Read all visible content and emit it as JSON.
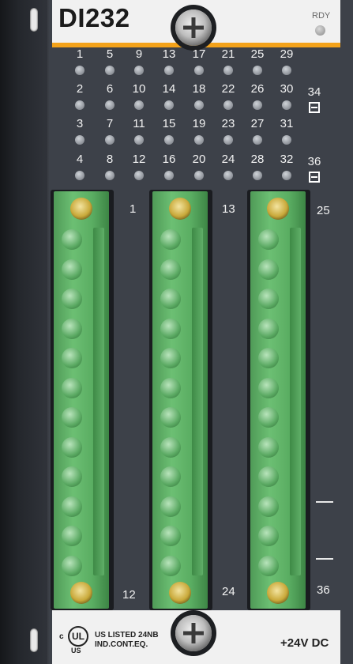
{
  "header": {
    "model": "DI232",
    "status_label": "RDY"
  },
  "leds": [
    {
      "label": "1"
    },
    {
      "label": "5"
    },
    {
      "label": "9"
    },
    {
      "label": "13"
    },
    {
      "label": "17"
    },
    {
      "label": "21"
    },
    {
      "label": "25"
    },
    {
      "label": "29"
    },
    {
      "label": "2"
    },
    {
      "label": "6"
    },
    {
      "label": "10"
    },
    {
      "label": "14"
    },
    {
      "label": "18"
    },
    {
      "label": "22"
    },
    {
      "label": "26"
    },
    {
      "label": "30"
    },
    {
      "label": "3"
    },
    {
      "label": "7"
    },
    {
      "label": "11"
    },
    {
      "label": "15"
    },
    {
      "label": "19"
    },
    {
      "label": "23"
    },
    {
      "label": "27"
    },
    {
      "label": "31"
    },
    {
      "label": "4"
    },
    {
      "label": "8"
    },
    {
      "label": "12"
    },
    {
      "label": "16"
    },
    {
      "label": "20"
    },
    {
      "label": "24"
    },
    {
      "label": "28"
    },
    {
      "label": "32"
    }
  ],
  "aux_leds": [
    {
      "label": "34"
    },
    {
      "label": "36"
    }
  ],
  "terminals": {
    "block1": {
      "top": "1",
      "bottom": "12"
    },
    "block2": {
      "top": "13",
      "bottom": "24"
    },
    "block3": {
      "top": "25",
      "bottom": "36"
    }
  },
  "footer": {
    "cert_c": "c",
    "cert_ul": "UL",
    "cert_us": "US",
    "listing_line1": "US LISTED 24NB",
    "listing_line2": "IND.CONT.EQ.",
    "supply": "+24V DC"
  },
  "colors": {
    "accent": "#f3a21a",
    "connector": "#5aad62",
    "housing": "#3d4149"
  }
}
